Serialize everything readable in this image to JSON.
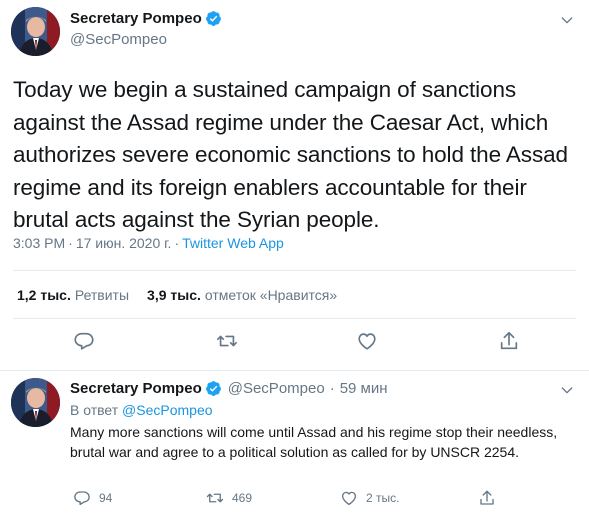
{
  "main_tweet": {
    "display_name": "Secretary Pompeo",
    "handle": "@SecPompeo",
    "text": "Today we begin a sustained campaign of sanctions against the Assad regime under the Caesar Act, which authorizes severe economic sanctions to hold the Assad regime and its foreign enablers accountable for their brutal acts against the Syrian people.",
    "time": "3:03 PM",
    "date": "17 июн. 2020 г.",
    "separator": "·",
    "source_app": "Twitter Web App",
    "retweets_count": "1,2 тыс.",
    "retweets_label": "Ретвиты",
    "likes_count": "3,9 тыс.",
    "likes_label": "отметок «Нравится»"
  },
  "reply_tweet": {
    "display_name": "Secretary Pompeo",
    "handle": "@SecPompeo",
    "separator": "·",
    "time": "59 мин",
    "reply_to_label": "В ответ",
    "reply_to_handle": "@SecPompeo",
    "text": "Many more sanctions will come until Assad and his regime stop their needless, brutal war and agree to a political solution as called for by UNSCR 2254.",
    "replies_count": "94",
    "retweets_count": "469",
    "likes_count": "2 тыс."
  },
  "colors": {
    "text_primary": "#14171a",
    "text_secondary": "#657786",
    "link": "#1b95e0",
    "verified": "#1da1f2",
    "divider": "#e6ecf0"
  },
  "icons": {
    "verified": "verified-badge-icon",
    "caret": "chevron-down-icon",
    "reply": "reply-icon",
    "retweet": "retweet-icon",
    "like": "heart-icon",
    "share": "share-icon"
  }
}
